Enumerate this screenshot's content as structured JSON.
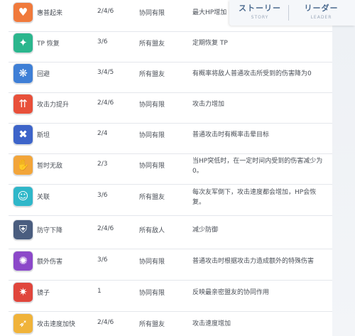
{
  "header_tabs": {
    "story_jp": "ストーリー",
    "story_en": "STORY",
    "leader_jp": "リーダー",
    "leader_en": "LEADER"
  },
  "rows": [
    {
      "icon": "heart-icon",
      "icon_color": "#f07a3c",
      "glyph": "♥",
      "name": "惠普起来",
      "count": "2/4/6",
      "target": "协同有限",
      "effect": "最大HP增加"
    },
    {
      "icon": "sparkle-icon",
      "icon_color": "#2bb68d",
      "glyph": "✦",
      "name": "TP 恢复",
      "count": "3/6",
      "target": "所有盟友",
      "effect": "定期恢复 TP"
    },
    {
      "icon": "dodge-icon",
      "icon_color": "#3f7fd6",
      "glyph": "❋",
      "name": "回避",
      "count": "3/4/5",
      "target": "所有盟友",
      "effect": "有概率将敌人普通攻击所受到的伤害降为0"
    },
    {
      "icon": "attack-up-icon",
      "icon_color": "#e8503a",
      "glyph": "⇈",
      "name": "攻击力提升",
      "count": "2/4/6",
      "target": "协同有限",
      "effect": "攻击力增加"
    },
    {
      "icon": "break-icon",
      "icon_color": "#3d64c9",
      "glyph": "✖",
      "name": "斯坦",
      "count": "2/4",
      "target": "协同有限",
      "effect": "普通攻击时有概率击晕目标"
    },
    {
      "icon": "invincible-icon",
      "icon_color": "#f2a53a",
      "glyph": "✋",
      "name": "暂时无敌",
      "count": "2/3",
      "target": "协同有限",
      "effect": "当HP突低时，在一定时间内受到的伤害减少为0。"
    },
    {
      "icon": "bond-icon",
      "icon_color": "#2fb7c9",
      "glyph": "☺",
      "name": "关联",
      "count": "3/6",
      "target": "所有盟友",
      "effect": "每次友军倒下，攻击速度都会增加，HP会恢复。"
    },
    {
      "icon": "defense-down-icon",
      "icon_color": "#4a5d7f",
      "glyph": "⛨",
      "name": "防守下降",
      "count": "2/4/6",
      "target": "所有敌人",
      "effect": "减少防御"
    },
    {
      "icon": "extra-damage-icon",
      "icon_color": "#8c48c9",
      "glyph": "✺",
      "name": "额外伤害",
      "count": "3/6",
      "target": "协同有限",
      "effect": "普通攻击时根据攻击力造成额外的特殊伤害"
    },
    {
      "icon": "mirror-icon",
      "icon_color": "#e0463c",
      "glyph": "✷",
      "name": "镜子",
      "count": "1",
      "target": "协同有限",
      "effect": "反映最亲密盟友的协同作用"
    },
    {
      "icon": "attack-speed-icon",
      "icon_color": "#f0b33a",
      "glyph": "➶",
      "name": "攻击速度加快",
      "count": "2/4/6",
      "target": "所有盟友",
      "effect": "攻击速度增加"
    }
  ]
}
